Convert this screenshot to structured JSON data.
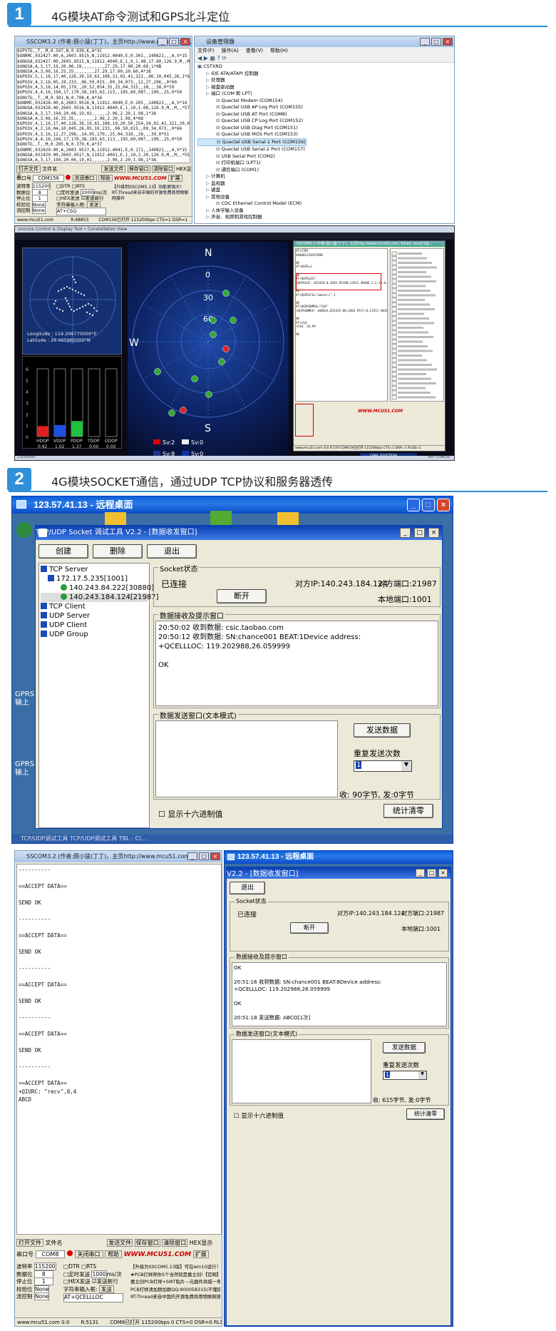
{
  "section1": {
    "number": "1",
    "title": "4G模块AT命令测试和GPS北斗定位"
  },
  "section2": {
    "number": "2",
    "title": "4G模块SOCKET通信，通过UDP TCP协议和服务器透传"
  },
  "sscom1": {
    "title": "SSCOM3.2 (作者:聂小猛(丁丁)，主页http://www.mcu51.com, Email: mc...",
    "lines": [
      "$GPVTG,,T,,M,0.507,N,0.939,K,A*3C",
      "$GNRMC,032427.00,A,2603.9515,N,11912.4040,E,0.301,,140821,,,A,V*15",
      "$GNGGA,032427.00,2603.9515,N,11912.4040,E,1,9,1.08,17.60,126.9,M,,M,,*63",
      "$GNGSA,A,3,17,19,20,06,19,,,,,,,,,27.29,17.00,20.60,1*0B",
      "$GNGSA,A,3,06,16,25,35,,,,,,,,27.29,17.00,20.60,4*38",
      "$GPGSV,5,1,16,17,40,126,39,19,63,108,31,02,41,321,,06,10,045,26,1*64",
      "$GPGSV,4,2,16,05,19,233,,06,50,015,,09,34,073,,12,27,296,,0*60",
      "$GPGSV,4,3,16,14,05,170,,20,52,054,35,25,04,315,,28,,,38,0*59",
      "$GPGSV,4,4,16,194,17,170,38,193,63,113,,195,69,087,,199,,25,0*50",
      "$GNVTG,,T,,M,0.301,N,0.708,K,A*36",
      "$GNRMC,032428.00,A,2603.9516,N,11912.4040,E,0.205,,140821,,,A,V*14",
      "$GNGGA,032428.00,2603.9516,N,11912.4040,E,1,10,1.08,126.9,M,,M,,*57",
      "$GNGSA,A,3,17,194,20,06,19,02,,,,,,2.96,2.20,1.98,1*3A",
      "$GNGSA,A,3,06,16,25,35,,,,,,,,2.96,2.20,1.98,4*08",
      "$GPGSV,4,1,16,17,40,126,39,19,63,108,19,20,50,254,34,02,41,321,20,0*60",
      "$GPGSV,4,2,16,04,10,045,26,05,19,233,,06,50,015,,09,34,073,,0*66",
      "$GPGSV,4,3,16,12,27,296,,14,05,170,,25,04,310,,28,,,39,0*51",
      "$GPGSV,4,4,16,194,17,170,38,193,63,113,,195,69,087,,199,,25,0*50",
      "$GNVTG,,T,,M,0.205,N,0.379,K,A*37",
      "$GNRMC,032429.00,A,2603.9517,N,11912.4041,E,0.171,,140821,,,A,V*15",
      "$GNGGA,032429.00,2603.9517,N,11912.4041,E,1,10,2.20,126.9,M,,M,,*55",
      "$GNGSA,A,3,17,194,20,06,19,02,,,,,,2.96,2.20,1.98,1*3A",
      "$GNGSA,A,3,06,16,25,35,,,,,,,,2.96,2.20,1.98,4*08",
      "$GPGSV,4,1,16,17,40,126,39,19,63,108,19,20,50,254,33,02,41,321,23,0*64",
      "$GPGSV,4,2,16,04,10,045,26,05,19,233,,06,50,015,,09,34,073,,0*66",
      "$GPGSV,4,3,16,12,27,296,,14,05,170,,25,04,310,,28,,,40,0*5F",
      "$GPGSV,4,4,16,194,17,170,38,193,63,113,,195,69,087,,199,,25,0*50",
      "$GPVTG,,T,,M,0.171,N,0.316,K,A*3E"
    ],
    "open_file": "打开文件",
    "file_name": "文件名",
    "send_file": "发送文件",
    "save_win": "保存窗口",
    "clear_win": "清除窗口",
    "hex_show": "HEX显示",
    "port_label": "串口号",
    "port_value": "COM156",
    "close_port": "关闭串口",
    "help": "帮助",
    "brand": "WWW.MCU51.COM",
    "expand": "扩展",
    "baud_label": "波特率",
    "baud": "115200",
    "data_label": "数据位",
    "data_bits": "8",
    "stop_label": "停止位",
    "stop_bits": "1",
    "parity_label": "校验位",
    "parity": "None",
    "flow_label": "流控制",
    "flow": "None",
    "dtr": "DTR",
    "rts": "RTS",
    "timed": "定时发送",
    "interval": "2000",
    "unit": "ms/次",
    "hex_send": "HEX发送",
    "send_newline": "发送新行",
    "input_label": "字符串输入框:",
    "send": "发送",
    "input_value": "AT+CSQ",
    "notice1": "【升级到SSCOM5.13】功能更强大！",
    "notice2": "RT-Thread来自中国的开源免费商用物联网操作",
    "status": [
      "www.mcu51.com S:0",
      "R:48853",
      "COM156已打开 115200bps CTS=1 DSR=1 RL"
    ]
  },
  "devmgr": {
    "title": "设备管理器",
    "menu": [
      "文件(F)",
      "操作(A)",
      "查看(V)",
      "帮助(H)"
    ],
    "items": [
      "CSTXRD",
      "IDE ATA/ATAPI 控制器",
      "处理器",
      "磁盘驱动器",
      "端口 (COM 和 LPT)",
      "Quectel Modem (COM154)",
      "Quectel USB AP Log Port (COM155)",
      "Quectel USB AT Port (COM8)",
      "Quectel USB CP Log Port (COM152)",
      "Quectel USB Diag Port (COM151)",
      "Quectel USB MOS Port (COM153)",
      "Quectel USB Serial-1 Port (COM156)",
      "Quectel USB Serial-2 Port (COM157)",
      "USB Serial Port (COM2)",
      "打印机端口 (LPT1)",
      "通信端口 (COM1)",
      "计算机",
      "监视器",
      "键盘",
      "其他设备",
      "CDC Ethernet Control Model (ECM)",
      "人体学输入设备",
      "声音、视频和游戏控制器"
    ]
  },
  "gps": {
    "title": "Unicore Control & Display Tool • Constellation View",
    "longitude": "Longitude : 119.206775000°E",
    "latitude": "Latitude    : 26.065865000°N",
    "bar_axis": [
      "6",
      "5",
      "4",
      "3",
      "2",
      "1",
      "0"
    ],
    "dop": [
      {
        "name": "HDOP",
        "value": "0.92",
        "level": 0.92,
        "color": "#e02020"
      },
      {
        "name": "VDOP",
        "value": "1.02",
        "level": 1.02,
        "color": "#2050e0"
      },
      {
        "name": "PDOP",
        "value": "1.37",
        "level": 1.37,
        "color": "#20c040"
      },
      {
        "name": "TDOP",
        "value": "0.00",
        "level": 0,
        "color": "#888"
      },
      {
        "name": "GDOP",
        "value": "0.00",
        "level": 0,
        "color": "#888"
      }
    ],
    "compass": {
      "n": "N",
      "s": "S",
      "w": "W",
      "r0": "0",
      "r30": "30",
      "r60": "60"
    },
    "legend": [
      {
        "flag": "cn",
        "label": "Sv:2"
      },
      {
        "flag": "ru",
        "label": "Sv:0"
      },
      {
        "flag": "us",
        "label": "Sv:8"
      },
      {
        "flag": "eu",
        "label": "Sv:0"
      }
    ],
    "connected": "Connected",
    "gps_system": "GPS SYSTEM",
    "port_info": "Port: COM156"
  },
  "sscom2": {
    "title": "SSCOM3.2 (作者:聂小猛(丁丁)，主页http://www.mcu51.com, Email: mcu51@...",
    "lines": [
      "AT+CIMI",
      "460001234567890",
      "",
      "OK",
      "AT+QGPS=1",
      "",
      "OK",
      "AT+QGPSLOC?",
      "+QGPSLOC: 032428.0,2603.9516N,11912.4040E,1.2,38.0,2,0.00,0.0,0.0,140821,10",
      "",
      "OK",
      "AT+QGPSCFG=\"nmeasrc\",1",
      "",
      "OK",
      "AT+QGPSGNMEA=\"GGA\"",
      "+QGPSGNMEA: $GNGGA,032429.00,2603.9517,N,11912.4041,E,1,10,2.20,126.9,M,,M,,*55",
      "",
      "OK",
      "AT+CSQ",
      "+CSQ: 26,99",
      "",
      "OK"
    ],
    "brand": "WWW.MCU51.COM",
    "status": "www.mcu51.com S:0  R:570  COM156已打开 115200bps CTS=1 DSR=1 RLSD=1"
  },
  "rdp1": {
    "title": "123.57.41.13 - 远程桌面",
    "desktop_side": [
      "GPRS输上",
      "GPRS输上"
    ],
    "tool_title": "TCP/UDP Socket 调试工具 V2.2 - [数据收发窗口]",
    "btn_create": "创建",
    "btn_delete": "删除",
    "btn_exit": "退出",
    "tree": [
      "TCP Server",
      "172.17.5.235[1001]",
      "140.243.84.222[30880]",
      "140.243.184.124[21987]",
      "TCP Client",
      "UDP Server",
      "UDP Client",
      "UDP Group"
    ],
    "socket_state": "Socket状态",
    "connected": "已连接",
    "peer_ip": "对方IP:140.243.184.124",
    "peer_port": "对方端口:21987",
    "local_port": "本地端口:1001",
    "disconnect": "断开",
    "recv_title": "数据接收及提示窗口",
    "recv_lines": [
      "20:50:02 收到数据:  csic.taobao.com",
      "20:50:12 收到数据:  SN:chance001 BEAT:1Device address:",
      "+QCELLLOC: 119.202988,26.059999",
      "",
      "OK"
    ],
    "send_title": "数据发送窗口(文本模式)",
    "send_btn": "发送数据",
    "repeat": "重复发送次数",
    "repeat_value": "1",
    "stats": "收: 90字节, 发:0字节",
    "hex": "显示十六进制值",
    "clear_stats": "统计清零",
    "taskbar": "TCP/UDP调试工具    TCP/UDP调试工具    TBL - Cl..."
  },
  "sscom3": {
    "title": "SSCOM3.2 (作者:聂小猛(丁丁)，主页http://www.mcu51.com,...",
    "lines": [
      "----------",
      "",
      "==ACCEPT DATA==",
      "",
      "SEND OK",
      "",
      "----------",
      "",
      "==ACCEPT DATA==",
      "",
      "SEND OK",
      "",
      "----------",
      "",
      "==ACCEPT DATA==",
      "",
      "SEND OK",
      "",
      "----------",
      "",
      "==ACCEPT DATA==",
      "",
      "SEND OK",
      "",
      "----------",
      "",
      "==ACCEPT DATA==",
      "+QIURC: \"recv\",0,4",
      "ABCD"
    ],
    "open_file": "打开文件",
    "file_name": "文件名",
    "send_file": "发送文件",
    "save_win": "保存窗口",
    "clear_win": "清除窗口",
    "hex_show": "HEX显示",
    "port_label": "串口号",
    "port_value": "COM8",
    "close_port": "关闭串口",
    "help": "帮助",
    "brand": "WWW.MCU51.COM",
    "expand": "扩展",
    "baud_label": "波特率",
    "baud": "115200",
    "data_label": "数据位",
    "data_bits": "8",
    "stop_label": "停止位",
    "stop_bits": "1",
    "parity_label": "校验位",
    "parity": "None",
    "flow_label": "流控制",
    "flow": "None",
    "dtr": "DTR",
    "rts": "RTS",
    "timed": "定时发送",
    "interval": "1000",
    "unit": "ms/次",
    "hex_send": "HEX发送",
    "send_newline": "发送新行",
    "input_label": "字符串输入框:",
    "send": "发送",
    "input_value": "AT+QCELLLOC",
    "notice": [
      "【升级为SSCOM5.13版】可在win10运行！",
      "★PCB打样帮你5个当然就是嘉立创!【官网】",
      "嘉立创PCB打样+SMT贴片—元器件商城一条龙服务",
      "PCB打样请加群加群QQ:800058315(不懂技术)",
      "RT-Thread来自中国的开源免费商用物联网操作系统"
    ],
    "status": [
      "www.mcu51.com S:0",
      "R:5131",
      "COM8已打开  115200bps  0  CTS=0 DSR=0 RLSD=0"
    ]
  },
  "rdp2": {
    "title": "123.57.41.13 - 远程桌面",
    "tool_title": "V2.2 - [数据收发窗口]",
    "btn_exit": "退出",
    "socket_state": "Socket状态",
    "connected": "已连接",
    "peer_ip": "对方IP:140.243.184.124",
    "peer_port": "对方端口:21987",
    "local_port": "本地端口:1001",
    "disconnect": "断开",
    "recv_title": "数据接收及提示窗口",
    "recv_lines": [
      "OK",
      "",
      "20:51:16 收到数据:  SN:chance001 BEAT:8Device address:",
      "+QCELLLOC: 119.202988,26.059999",
      "",
      "OK",
      "",
      "20:51:18 发送数据:  ABCD[1次]"
    ],
    "send_title": "数据发送窗口(文本模式)",
    "send_btn": "发送数据",
    "repeat": "重复发送次数",
    "repeat_value": "1",
    "stats": "收: 615字节, 发:0字节",
    "hex": "显示十六进制值",
    "clear_stats": "统计清零"
  }
}
